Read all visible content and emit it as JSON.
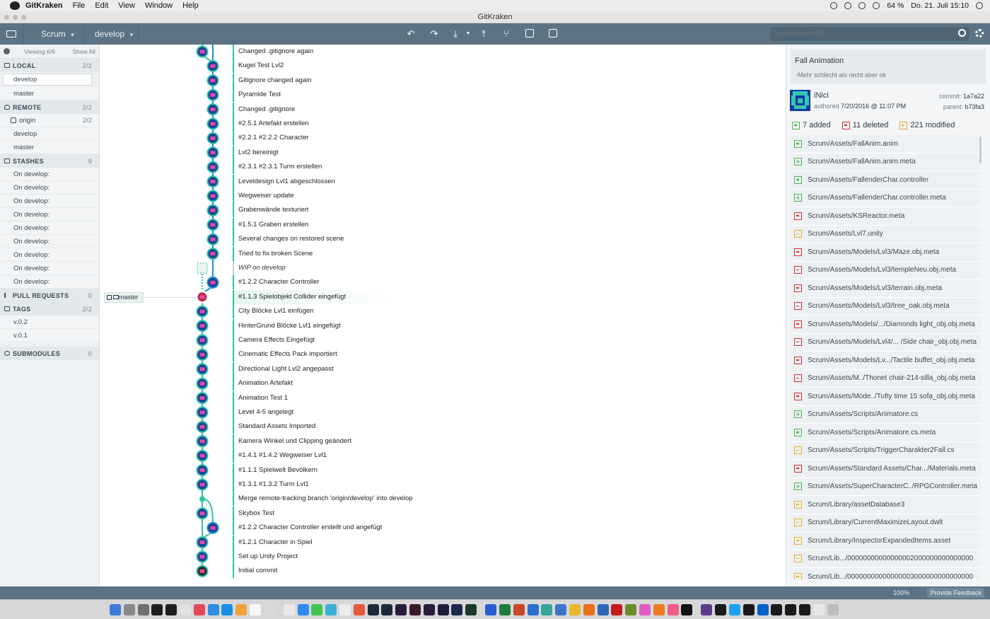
{
  "menubar": {
    "app": "GitKraken",
    "items": [
      "File",
      "Edit",
      "View",
      "Window",
      "Help"
    ],
    "battery": "64 %",
    "datetime": "Do. 21. Juli  15:10"
  },
  "window_title": "GitKraken",
  "toolbar": {
    "repo": "Scrum",
    "branch": "develop",
    "search_placeholder": "search commits",
    "undo_icon": "undo-icon",
    "redo_icon": "redo-icon",
    "pull_icon": "pull-icon",
    "push_icon": "push-icon",
    "branch_icon": "branch-icon",
    "stash_icon": "stash-icon",
    "pop_icon": "pop-icon"
  },
  "sidebar": {
    "viewing": "Viewing 6/6",
    "show_all": "Show All",
    "local": {
      "label": "LOCAL",
      "count": "2/2",
      "items": [
        "develop",
        "master"
      ]
    },
    "remote": {
      "label": "REMOTE",
      "count": "2/2",
      "origin": "origin",
      "origin_count": "2/2",
      "items": [
        "develop",
        "master"
      ]
    },
    "stashes": {
      "label": "STASHES",
      "count": "9",
      "items": [
        "On develop:",
        "On develop:",
        "On develop:",
        "On develop:",
        "On develop:",
        "On develop:",
        "On develop:",
        "On develop:",
        "On develop:"
      ]
    },
    "pull_requests": {
      "label": "PULL REQUESTS",
      "count": "0"
    },
    "tags": {
      "label": "TAGS",
      "count": "2/2",
      "items": [
        "v.0.2",
        "v.0.1"
      ]
    },
    "submodules": {
      "label": "SUBMODULES",
      "count": "0"
    }
  },
  "graph": {
    "branch_label": "master",
    "commits": [
      "Changed .gitignore again",
      "Kugel Test Lvl2",
      "Gitignore changed again",
      "Pyramide Test",
      "Changed .gitignore",
      "#2.5.1 Artefakt erstellen",
      "#2.2.1 #2.2.2 Character",
      "Lvl2 bereinigt",
      "#2.3.1 #2.3.1 Turm erstellen",
      "Leveldesign Lvl1 abgeschlossen",
      "Wegweiser update",
      "Grabenwände texturiert",
      "#1.5.1 Graben erstellen",
      "Several changes on restored scene",
      "Tried to fix broken Scene",
      "WIP on develop",
      "#1.2.2 Character Controller",
      "#1.1.3 Spielobjekt Collider eingefügt",
      "City Blöcke Lvl1 einfügen",
      "HinterGrund Blöcke Lvl1 eingefügt",
      "Camera Effects Eingefügt",
      "Cinematic Effects Pack importiert",
      "Directional Light Lvl2 angepasst",
      "Animation Artefakt",
      "Animation Test 1",
      "Level 4-5 angelegt",
      "Standard Assets Imported",
      "Kamera Winkel und Clipping geändert",
      "#1.4.1 #1.4.2 Wegweiser Lvl1",
      "#1.1.1 Spielwelt Bevölkern",
      "#1.3.1 #1.3.2 Turm Lvl1",
      "Merge remote-tracking branch 'origin/develop' into develop",
      "Skybox Test",
      "#1.2.2 Character Controller erstellt und angefügt",
      "#1.2.1 Character in Spiel",
      "Set up Unity Project",
      "Initial commit"
    ]
  },
  "commit_detail": {
    "title": "Fall Animation",
    "description": "-Mehr schlecht als recht aber ok",
    "author": "iNici",
    "authored_label": "authored",
    "authored_date": "7/20/2016 @ 11:07 PM",
    "commit_label": "commit:",
    "commit_sha": "1a7a22",
    "parent_label": "parent:",
    "parent_sha": "b73fa3",
    "added": "7 added",
    "deleted": "11 deleted",
    "modified": "221 modified",
    "files": [
      {
        "path": "Scrum/Assets/FallAnim.anim",
        "status": "added"
      },
      {
        "path": "Scrum/Assets/FallAnim.anim.meta",
        "status": "added"
      },
      {
        "path": "Scrum/Assets/FallenderChar.controller",
        "status": "added"
      },
      {
        "path": "Scrum/Assets/FallenderChar.controller.meta",
        "status": "added"
      },
      {
        "path": "Scrum/Assets/KSReactor.meta",
        "status": "deleted"
      },
      {
        "path": "Scrum/Assets/Lvl7.unity",
        "status": "modified"
      },
      {
        "path": "Scrum/Assets/Models/Lvl3/Maze.obj.meta",
        "status": "deleted"
      },
      {
        "path": "Scrum/Assets/Models/Lvl3/templeNeu.obj.meta",
        "status": "deleted"
      },
      {
        "path": "Scrum/Assets/Models/Lvl3/terrain.obj.meta",
        "status": "deleted"
      },
      {
        "path": "Scrum/Assets/Models/Lvl3/tree_oak.obj.meta",
        "status": "deleted"
      },
      {
        "path": "Scrum/Assets/Models/.../Diamonds light_obj.obj.meta",
        "status": "deleted"
      },
      {
        "path": "Scrum/Assets/Models/Lvl4/... /Side chair_obj.obj.meta",
        "status": "deleted"
      },
      {
        "path": "Scrum/Assets/Models/Lv.../Tactile buffet_obj.obj.meta",
        "status": "deleted"
      },
      {
        "path": "Scrum/Assets/M../Thonet chair-214-silla_obj.obj.meta",
        "status": "deleted"
      },
      {
        "path": "Scrum/Assets/Mode../Tufty time 15 sofa_obj.obj.meta",
        "status": "deleted"
      },
      {
        "path": "Scrum/Assets/Scripts/Animatore.cs",
        "status": "added"
      },
      {
        "path": "Scrum/Assets/Scripts/Animatore.cs.meta",
        "status": "added"
      },
      {
        "path": "Scrum/Assets/Scripts/TriggerCharakter2Fall.cs",
        "status": "modified"
      },
      {
        "path": "Scrum/Assets/Standard Assets/Char.../Materials.meta",
        "status": "deleted"
      },
      {
        "path": "Scrum/Assets/SuperCharacterC../RPGController.meta",
        "status": "added"
      },
      {
        "path": "Scrum/Library/assetDatabase3",
        "status": "modified"
      },
      {
        "path": "Scrum/Library/CurrentMaximizeLayout.dwlt",
        "status": "modified"
      },
      {
        "path": "Scrum/Library/InspectorExpandedItems.asset",
        "status": "modified"
      },
      {
        "path": "Scrum/Lib.../00000000000000002000000000000000",
        "status": "modified"
      },
      {
        "path": "Scrum/Lib.../00000000000000003000000000000000",
        "status": "modified"
      }
    ]
  },
  "statusbar": {
    "zoom": "100%",
    "feedback": "Provide Feedback"
  },
  "colors": {
    "toolbar": "#5b7385",
    "graph_line": "#2ec4a3",
    "added": "#49b652",
    "deleted": "#d2313a",
    "modified": "#e8b127"
  }
}
